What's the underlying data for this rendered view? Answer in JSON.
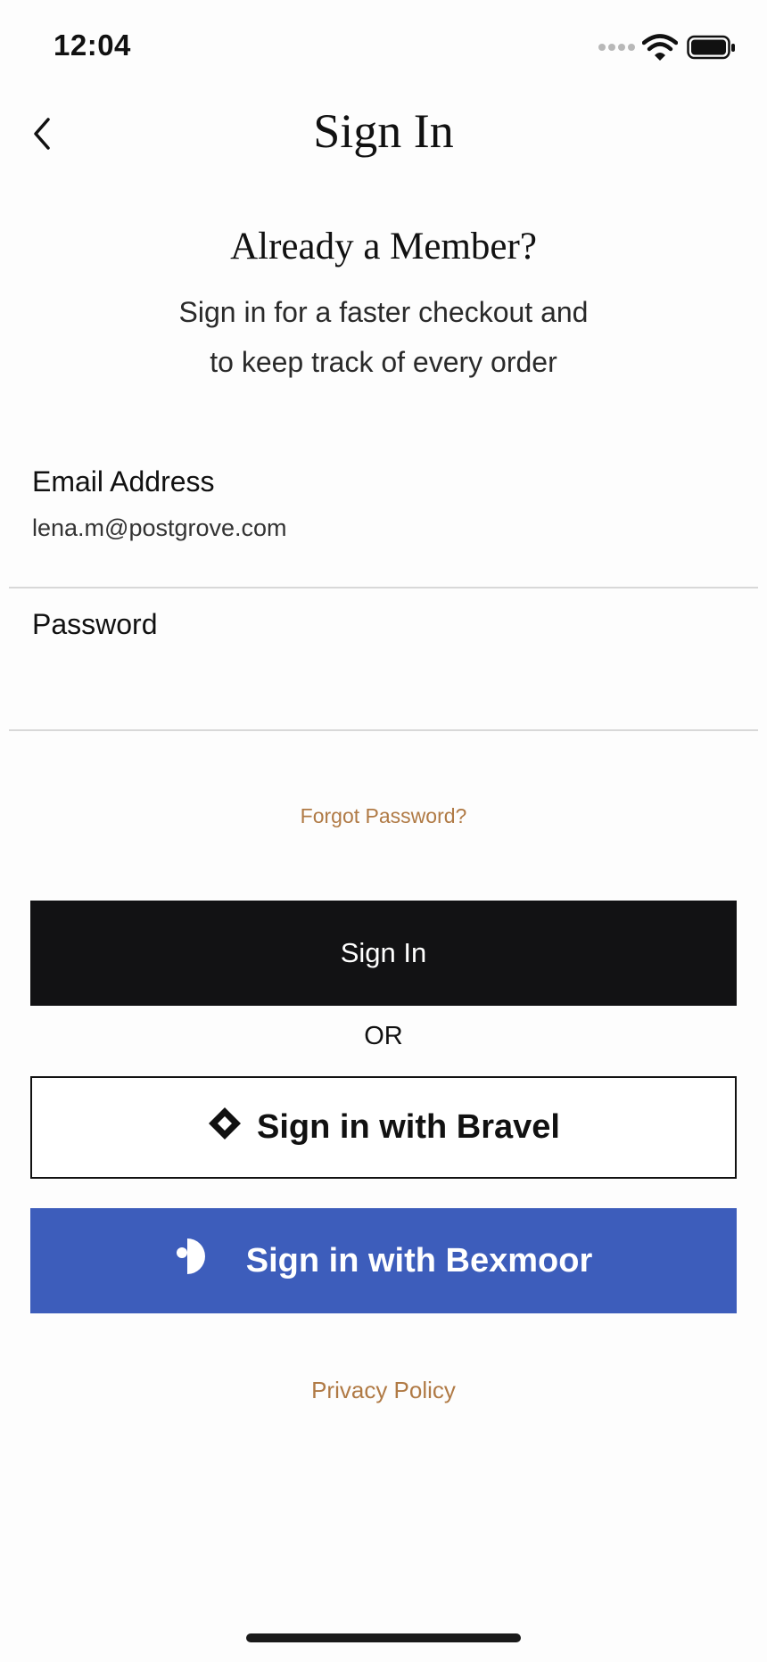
{
  "status_bar": {
    "time": "12:04"
  },
  "nav": {
    "title": "Sign In"
  },
  "intro": {
    "heading": "Already a Member?",
    "line1": "Sign in for a faster checkout and",
    "line2": "to keep track of every order"
  },
  "form": {
    "email": {
      "label": "Email Address",
      "value": "lena.m@postgrove.com"
    },
    "password": {
      "label": "Password",
      "value": ""
    },
    "forgot_label": "Forgot Password?"
  },
  "actions": {
    "sign_in_label": "Sign In",
    "or_label": "OR",
    "bravel_label": "Sign in with Bravel",
    "bexmoor_label": "Sign in with Bexmoor"
  },
  "footer": {
    "privacy_label": "Privacy Policy"
  },
  "colors": {
    "accent_link": "#b07a45",
    "primary_button": "#121214",
    "bexmoor_button": "#3d5dbb"
  },
  "icons": {
    "back": "chevron-left-icon",
    "signal": "cellular-signal-icon",
    "wifi": "wifi-icon",
    "battery": "battery-icon",
    "bravel": "bravel-logo-icon",
    "bexmoor": "bexmoor-logo-icon"
  }
}
